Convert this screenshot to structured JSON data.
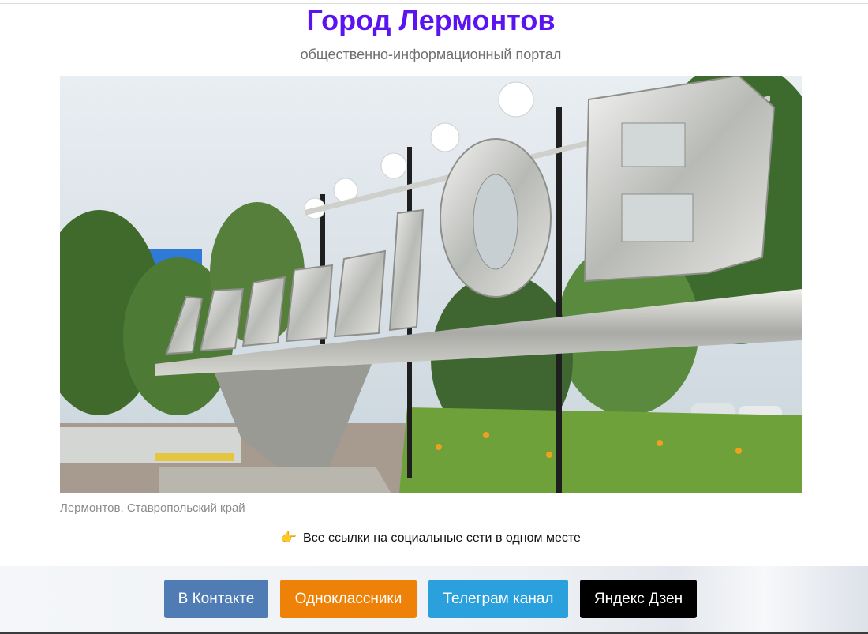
{
  "header": {
    "title": "Город Лермонтов",
    "subtitle": "общественно-информационный портал"
  },
  "photo": {
    "caption": "Лермонтов, Ставропольский край",
    "sign_text": "ЛЕРМОНТОВ"
  },
  "social": {
    "intro_icon": "pointing-hand-icon",
    "intro_text": "Все ссылки на социальные сети в одном месте",
    "buttons": [
      {
        "label": "В Контакте",
        "color": "#4f7cb4"
      },
      {
        "label": "Одноклассники",
        "color": "#ee8208"
      },
      {
        "label": "Телеграм канал",
        "color": "#2aa0dc"
      },
      {
        "label": "Яндекс Дзен",
        "color": "#000000"
      }
    ]
  },
  "colors": {
    "title": "#5b14f0",
    "subtitle": "#6f6f6f",
    "caption": "#8b8b8b"
  }
}
